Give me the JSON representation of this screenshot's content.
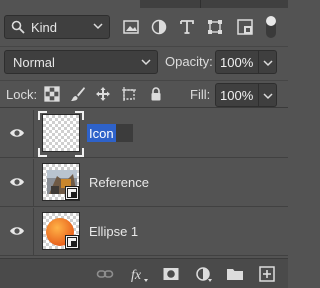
{
  "filter": {
    "kind_label": "Kind"
  },
  "blend": {
    "mode": "Normal",
    "opacity_label": "Opacity:",
    "opacity_value": "100%"
  },
  "lock": {
    "label": "Lock:",
    "fill_label": "Fill:",
    "fill_value": "100%"
  },
  "layers": [
    {
      "name": "Icon",
      "editing": true,
      "visible": true
    },
    {
      "name": "Reference",
      "visible": true
    },
    {
      "name": "Ellipse 1",
      "visible": true
    }
  ],
  "colors": {
    "panel": "#535353",
    "field": "#3f3f3f",
    "selection": "#2e62c9",
    "accent_orange": "#f2892a"
  }
}
